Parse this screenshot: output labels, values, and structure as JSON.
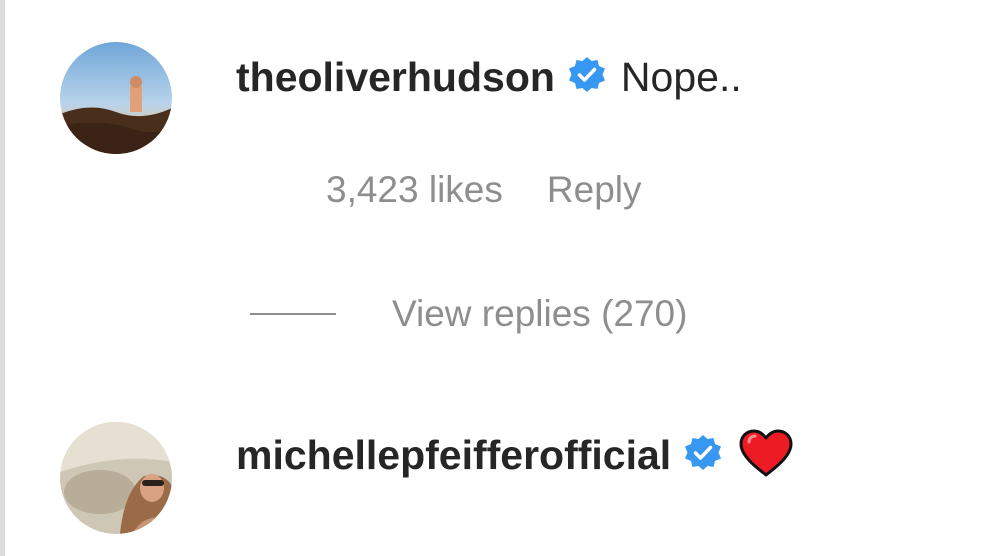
{
  "comments": [
    {
      "username": "theoliverhudson",
      "verified": true,
      "text": "Nope..",
      "likes": "3,423 likes",
      "reply_label": "Reply",
      "view_replies": "View replies (270)"
    },
    {
      "username": "michellepfeifferofficial",
      "verified": true,
      "text": "",
      "emoji": "heart",
      "likes": "",
      "reply_label": ""
    }
  ],
  "colors": {
    "text_primary": "#262626",
    "text_secondary": "#8e8e8e",
    "verified_blue": "#3897f0",
    "heart_red": "#ed1c24"
  },
  "icons": {
    "verified": "verified-badge-icon",
    "heart": "red-heart-emoji"
  }
}
